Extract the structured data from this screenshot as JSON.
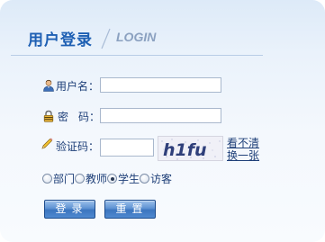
{
  "header": {
    "title": "用户登录",
    "subtitle": "LOGIN"
  },
  "form": {
    "username_label": "用户名：",
    "username_value": "",
    "password_label_a": "密",
    "password_label_b": "码：",
    "password_value": "",
    "captcha_label": "验证码：",
    "captcha_value": "",
    "captcha_image_text": "h1fu",
    "captcha_refresh_line1": "看不清",
    "captcha_refresh_line2": "换一张"
  },
  "roles": {
    "selected": "学生",
    "options": [
      "部门",
      "教师",
      "学生",
      "访客"
    ]
  },
  "buttons": {
    "login": "登录",
    "reset": "重置"
  },
  "icons": {
    "username": "user-icon",
    "password": "lock-icon",
    "captcha": "pencil-icon"
  },
  "colors": {
    "title": "#1d5fb3",
    "subtitle": "#8ba1c0",
    "label": "#1e3f78",
    "button": "#4a84cc"
  }
}
